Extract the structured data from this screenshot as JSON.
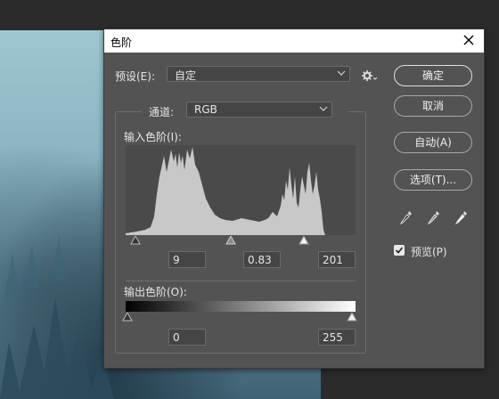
{
  "dialog": {
    "title": "色阶",
    "preset_label": "预设(E):",
    "preset_value": "自定",
    "channel_label": "通道:",
    "channel_value": "RGB",
    "input_levels_label": "输入色阶(I):",
    "output_levels_label": "输出色阶(O):",
    "input_black": "9",
    "input_gamma": "0.83",
    "input_white": "201",
    "output_black": "0",
    "output_white": "255",
    "buttons": {
      "ok": "确定",
      "cancel": "取消",
      "auto": "自动(A)",
      "options": "选项(T)..."
    },
    "preview_label": "预览(P)",
    "preview_checked": true
  },
  "icons": [
    "close-icon",
    "chevron-down-icon",
    "gear-icon",
    "black-eyedropper-icon",
    "gray-eyedropper-icon",
    "white-eyedropper-icon",
    "checkmark-icon"
  ],
  "colors": {
    "dialog_bg": "#535353",
    "histogram_fill": "#c8c8c8",
    "histogram_bg": "#4a4a4a"
  }
}
